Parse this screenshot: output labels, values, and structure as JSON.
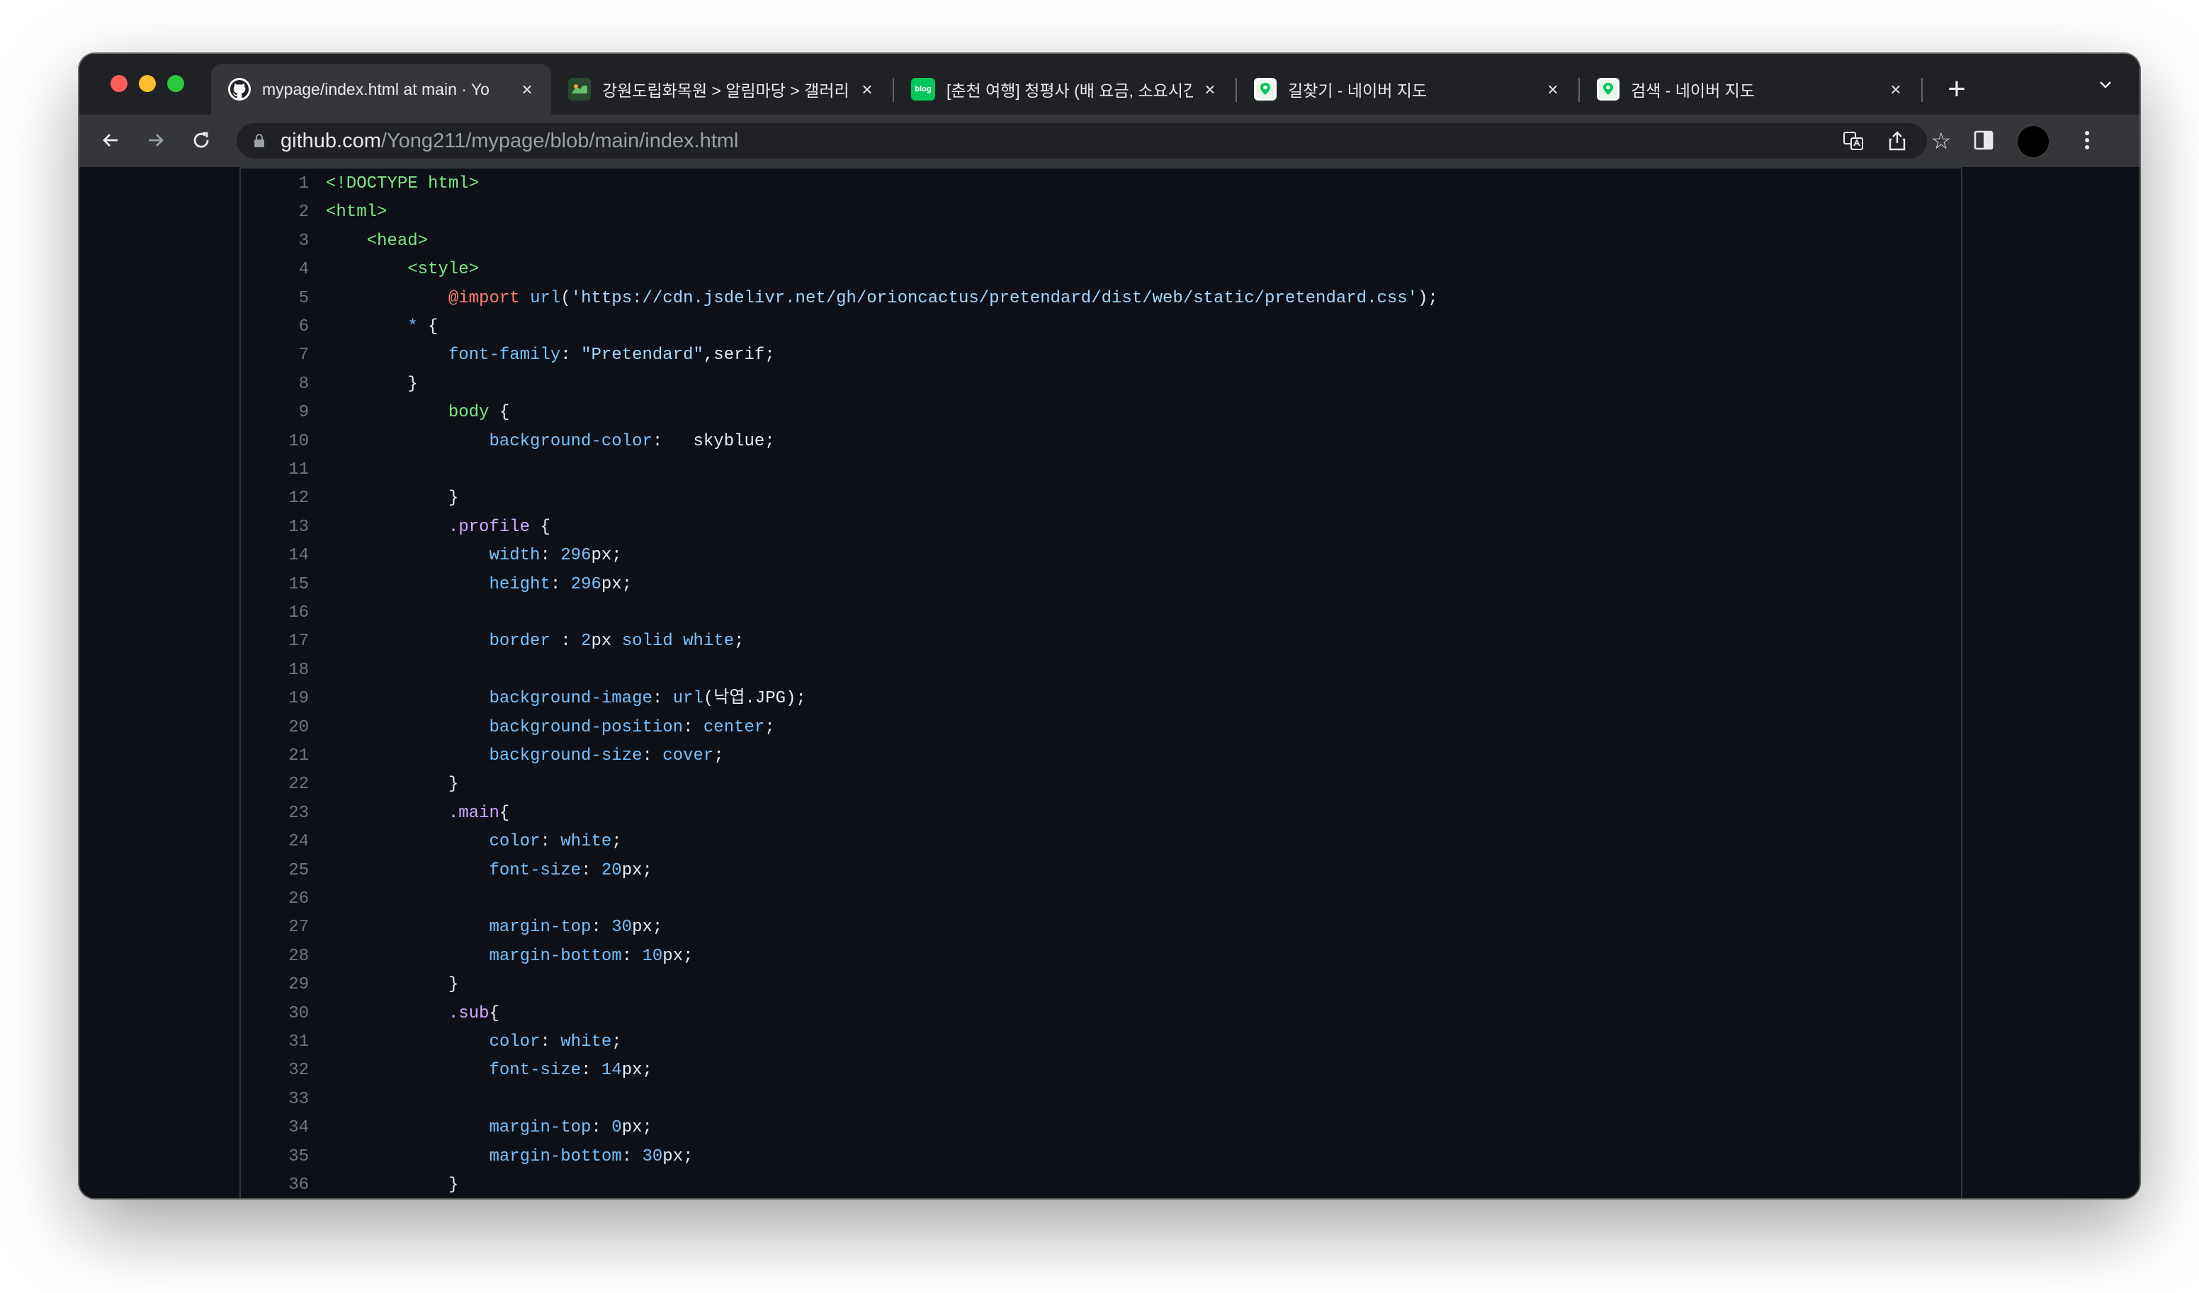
{
  "browser": {
    "tabs": [
      {
        "title": "mypage/index.html at main · Yo",
        "icon": "github-icon",
        "active": true
      },
      {
        "title": "강원도립화목원 > 알림마당 > 갤러리",
        "icon": "garden-favicon",
        "active": false
      },
      {
        "title": "[춘천 여행] 청평사 (배 요금, 소요시간",
        "icon": "blog-favicon",
        "icon_label": "blog",
        "active": false
      },
      {
        "title": "길찾기 - 네이버 지도",
        "icon": "naver-map-favicon",
        "active": false
      },
      {
        "title": "검색 - 네이버 지도",
        "icon": "naver-map-favicon",
        "active": false
      }
    ],
    "new_tab_label": "+",
    "address": {
      "host": "github.com",
      "path": "/Yong211/mypage/blob/main/index.html"
    }
  },
  "code": {
    "lines": [
      {
        "n": "1",
        "text": "<!DOCTYPE html>"
      },
      {
        "n": "2",
        "text": "<html>"
      },
      {
        "n": "3",
        "text": "    <head>"
      },
      {
        "n": "4",
        "text": "        <style>"
      },
      {
        "n": "5",
        "text": "            @import url('https://cdn.jsdelivr.net/gh/orioncactus/pretendard/dist/web/static/pretendard.css');"
      },
      {
        "n": "6",
        "text": "        * {"
      },
      {
        "n": "7",
        "text": "            font-family: \"Pretendard\",serif;"
      },
      {
        "n": "8",
        "text": "        }"
      },
      {
        "n": "9",
        "text": "            body {"
      },
      {
        "n": "10",
        "text": "                background-color:   skyblue;"
      },
      {
        "n": "11",
        "text": ""
      },
      {
        "n": "12",
        "text": "            }"
      },
      {
        "n": "13",
        "text": "            .profile {"
      },
      {
        "n": "14",
        "text": "                width: 296px;"
      },
      {
        "n": "15",
        "text": "                height: 296px;"
      },
      {
        "n": "16",
        "text": ""
      },
      {
        "n": "17",
        "text": "                border : 2px solid white;"
      },
      {
        "n": "18",
        "text": ""
      },
      {
        "n": "19",
        "text": "                background-image: url(낙엽.JPG);"
      },
      {
        "n": "20",
        "text": "                background-position: center;"
      },
      {
        "n": "21",
        "text": "                background-size: cover;"
      },
      {
        "n": "22",
        "text": "            }"
      },
      {
        "n": "23",
        "text": "            .main{"
      },
      {
        "n": "24",
        "text": "                color: white;"
      },
      {
        "n": "25",
        "text": "                font-size: 20px;"
      },
      {
        "n": "26",
        "text": ""
      },
      {
        "n": "27",
        "text": "                margin-top: 30px;"
      },
      {
        "n": "28",
        "text": "                margin-bottom: 10px;"
      },
      {
        "n": "29",
        "text": "            }"
      },
      {
        "n": "30",
        "text": "            .sub{"
      },
      {
        "n": "31",
        "text": "                color: white;"
      },
      {
        "n": "32",
        "text": "                font-size: 14px;"
      },
      {
        "n": "33",
        "text": ""
      },
      {
        "n": "34",
        "text": "                margin-top: 0px;"
      },
      {
        "n": "35",
        "text": "                margin-bottom: 30px;"
      },
      {
        "n": "36",
        "text": "            }"
      }
    ]
  },
  "colors": {
    "tabbar_bg": "#202124",
    "toolbar_bg": "#35363a",
    "code_bg": "#0d1117",
    "line_number": "#6e7681",
    "tag": "#7ee787",
    "property": "#79c0ff",
    "string": "#a5d6ff",
    "keyword": "#ff7b72",
    "selector": "#d2a8ff"
  }
}
